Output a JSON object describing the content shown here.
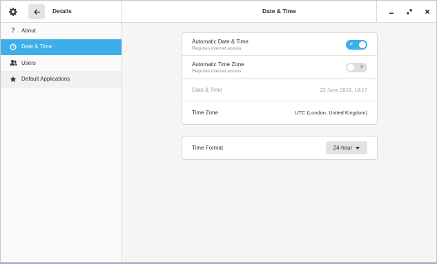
{
  "header": {
    "sidebar_title": "Details",
    "main_title": "Date & Time"
  },
  "sidebar": {
    "items": [
      {
        "label": "About",
        "icon": "question-icon"
      },
      {
        "label": "Date & Time",
        "icon": "clock-icon",
        "active": true
      },
      {
        "label": "Users",
        "icon": "users-icon"
      },
      {
        "label": "Default Applications",
        "icon": "star-icon"
      }
    ]
  },
  "datetime": {
    "auto_date": {
      "label": "Automatic Date & Time",
      "sublabel": "Requires internet access",
      "enabled": true
    },
    "auto_zone": {
      "label": "Automatic Time Zone",
      "sublabel": "Requires internet access",
      "enabled": false
    },
    "date_time": {
      "label": "Date & Time",
      "value": "22 June 2019, 18:17"
    },
    "time_zone": {
      "label": "Time Zone",
      "value": "UTC (London, United Kingdom)"
    }
  },
  "format": {
    "label": "Time Format",
    "selected": "24-hour"
  },
  "colors": {
    "accent": "#3daee9"
  }
}
